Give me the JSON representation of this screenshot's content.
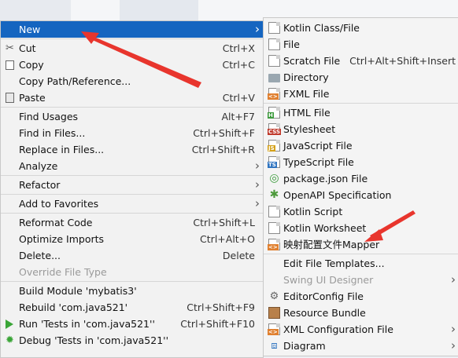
{
  "left_menu": [
    {
      "type": "item",
      "label": "New",
      "arrow": true,
      "selected": true,
      "icon": "new-icon"
    },
    {
      "type": "sep"
    },
    {
      "type": "item",
      "label": "Cut",
      "shortcut": "Ctrl+X",
      "icon": "scissors-icon"
    },
    {
      "type": "item",
      "label": "Copy",
      "shortcut": "Ctrl+C",
      "icon": "copy-icon"
    },
    {
      "type": "item",
      "label": "Copy Path/Reference..."
    },
    {
      "type": "item",
      "label": "Paste",
      "shortcut": "Ctrl+V",
      "icon": "paste-icon"
    },
    {
      "type": "sep"
    },
    {
      "type": "item",
      "label": "Find Usages",
      "shortcut": "Alt+F7"
    },
    {
      "type": "item",
      "label": "Find in Files...",
      "shortcut": "Ctrl+Shift+F"
    },
    {
      "type": "item",
      "label": "Replace in Files...",
      "shortcut": "Ctrl+Shift+R"
    },
    {
      "type": "item",
      "label": "Analyze",
      "arrow": true
    },
    {
      "type": "sep"
    },
    {
      "type": "item",
      "label": "Refactor",
      "arrow": true
    },
    {
      "type": "sep"
    },
    {
      "type": "item",
      "label": "Add to Favorites",
      "arrow": true
    },
    {
      "type": "sep"
    },
    {
      "type": "item",
      "label": "Reformat Code",
      "shortcut": "Ctrl+Shift+L"
    },
    {
      "type": "item",
      "label": "Optimize Imports",
      "shortcut": "Ctrl+Alt+O"
    },
    {
      "type": "item",
      "label": "Delete...",
      "shortcut": "Delete"
    },
    {
      "type": "item",
      "label": "Override File Type",
      "disabled": true
    },
    {
      "type": "sep"
    },
    {
      "type": "item",
      "label": "Build Module 'mybatis3'"
    },
    {
      "type": "item",
      "label": "Rebuild 'com.java521'",
      "shortcut": "Ctrl+Shift+F9"
    },
    {
      "type": "item",
      "label": "Run 'Tests in 'com.java521''",
      "shortcut": "Ctrl+Shift+F10",
      "icon": "run-icon"
    },
    {
      "type": "item",
      "label": "Debug 'Tests in 'com.java521''",
      "icon": "debug-icon"
    }
  ],
  "right_menu": [
    {
      "type": "item",
      "label": "Kotlin Class/File",
      "icon": "kotlin-class-icon"
    },
    {
      "type": "item",
      "label": "File",
      "icon": "file-icon"
    },
    {
      "type": "item",
      "label": "Scratch File",
      "shortcut": "Ctrl+Alt+Shift+Insert",
      "icon": "scratch-file-icon"
    },
    {
      "type": "item",
      "label": "Directory",
      "icon": "folder-icon"
    },
    {
      "type": "item",
      "label": "FXML File",
      "icon": "fxml-file-icon"
    },
    {
      "type": "sep"
    },
    {
      "type": "item",
      "label": "HTML File",
      "icon": "html-file-icon"
    },
    {
      "type": "item",
      "label": "Stylesheet",
      "icon": "css-file-icon"
    },
    {
      "type": "item",
      "label": "JavaScript File",
      "icon": "js-file-icon"
    },
    {
      "type": "item",
      "label": "TypeScript File",
      "icon": "ts-file-icon"
    },
    {
      "type": "item",
      "label": "package.json File",
      "icon": "package-json-icon"
    },
    {
      "type": "item",
      "label": "OpenAPI Specification",
      "icon": "openapi-icon"
    },
    {
      "type": "item",
      "label": "Kotlin Script",
      "icon": "kotlin-script-icon"
    },
    {
      "type": "item",
      "label": "Kotlin Worksheet",
      "icon": "kotlin-worksheet-icon"
    },
    {
      "type": "item",
      "label": "映射配置文件Mapper",
      "icon": "mapper-file-icon"
    },
    {
      "type": "sep"
    },
    {
      "type": "item",
      "label": "Edit File Templates..."
    },
    {
      "type": "item",
      "label": "Swing UI Designer",
      "disabled": true,
      "arrow": true
    },
    {
      "type": "item",
      "label": "EditorConfig File",
      "icon": "editorconfig-icon"
    },
    {
      "type": "item",
      "label": "Resource Bundle",
      "icon": "resource-bundle-icon"
    },
    {
      "type": "item",
      "label": "XML Configuration File",
      "arrow": true,
      "icon": "xml-config-icon"
    },
    {
      "type": "item",
      "label": "Diagram",
      "arrow": true,
      "icon": "diagram-icon"
    }
  ],
  "colors": {
    "selected": "#1565c0",
    "annotation": "#e8352d",
    "menu_bg": "#f2f2f2"
  }
}
